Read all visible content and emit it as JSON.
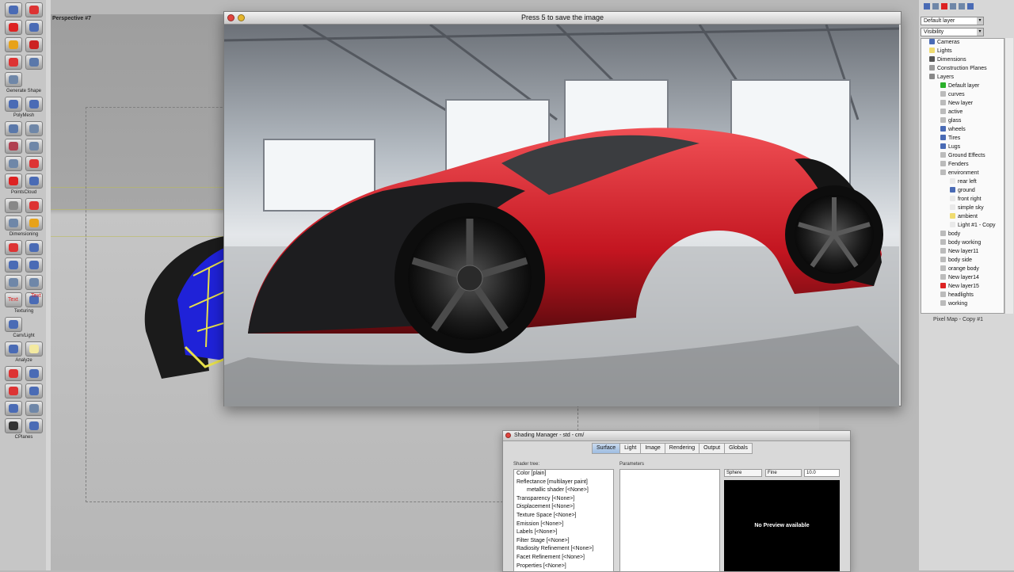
{
  "viewport": {
    "title": "Perspective #7"
  },
  "toolbar": {
    "groups": [
      {
        "label": "Generate Shape"
      },
      {
        "label": "PolyMesh"
      },
      {
        "label": "PointsCloud"
      },
      {
        "label": "Dimensioning"
      },
      {
        "label": "Texturing"
      },
      {
        "label": "Cam/Light"
      },
      {
        "label": "Analyze"
      },
      {
        "label": "CPlanes"
      }
    ],
    "text_tool_1": "Text",
    "text_tool_2": "Text"
  },
  "render_window": {
    "title": "Press 5 to save the image"
  },
  "right_panel": {
    "layer_select": "Default layer",
    "visibility_select": "Visibility",
    "tree": [
      "Cameras",
      "Lights",
      "Dimensions",
      "Construction Planes",
      "Layers",
      "Default layer",
      "curves",
      "New layer",
      "active",
      "glass",
      "wheels",
      "Tires",
      "Lugs",
      "Ground Effects",
      "Fenders",
      "environment",
      "rear left",
      "ground",
      "front right",
      "simple sky",
      "ambient",
      "Light #1 - Copy",
      "body",
      "body working",
      "New layer11",
      "body side",
      "orange body",
      "New layer14",
      "New layer15",
      "headlights",
      "working"
    ],
    "footer_item": "Pixel Map - Copy #1"
  },
  "shading_manager": {
    "title": "Shading Manager - std - cm/",
    "tabs": [
      "Surface",
      "Light",
      "Image",
      "Rendering",
      "Output",
      "Globals"
    ],
    "active_tab": "Surface",
    "shader_tree_label": "Shader tree:",
    "parameters_label": "Parameters",
    "shader_items": [
      "Color [plain]",
      "Reflectance [multilayer paint]",
      "metallic shader [<None>]",
      "Transparency [<None>]",
      "Displacement [<None>]",
      "Texture Space [<None>]",
      "Emission [<None>]",
      "Labels [<None>]",
      "Filter Stage [<None>]",
      "Radiosity Refinement [<None>]",
      "Facet Refinement [<None>]",
      "Properties [<None>]"
    ],
    "preview_shape": "Sphere",
    "preview_quality": "Fine",
    "preview_size": "10.0",
    "preview_text": "No Preview available"
  }
}
